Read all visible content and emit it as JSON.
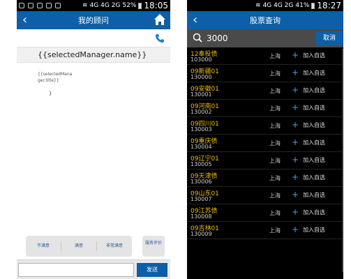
{
  "left_screen": {
    "status": {
      "signal_text": "4G 4G 2G",
      "battery": "52%",
      "time": "18:05"
    },
    "header": {
      "title": "我的顾问"
    },
    "manager": {
      "name": "{{selectedManager.name}}",
      "title": "{{selectedManager.title}}",
      "close_brace": "}"
    },
    "rating_buttons": [
      "不满意",
      "满意",
      "非常满意"
    ],
    "service_eval": "服务评价",
    "input": {
      "value": "",
      "placeholder": ""
    },
    "send_label": "发送"
  },
  "right_screen": {
    "status": {
      "signal_text": "4G 4G 2G",
      "battery": "41%",
      "time": "18:27"
    },
    "header": {
      "title": "股票查询"
    },
    "search": {
      "query": "3000"
    },
    "cancel_label": "取消",
    "stocks": [
      {
        "name": "12奉投债",
        "code": "103000",
        "area": "上海",
        "action": "加入自选"
      },
      {
        "name": "09新疆01",
        "code": "130000",
        "area": "上海",
        "action": "加入自选"
      },
      {
        "name": "09安徽01",
        "code": "130001",
        "area": "上海",
        "action": "加入自选"
      },
      {
        "name": "09河南01",
        "code": "130002",
        "area": "上海",
        "action": "加入自选"
      },
      {
        "name": "09四川01",
        "code": "130003",
        "area": "上海",
        "action": "加入自选"
      },
      {
        "name": "09重庆债",
        "code": "130004",
        "area": "上海",
        "action": "加入自选"
      },
      {
        "name": "09辽宁01",
        "code": "130005",
        "area": "上海",
        "action": "加入自选"
      },
      {
        "name": "09天津债",
        "code": "130006",
        "area": "上海",
        "action": "加入自选"
      },
      {
        "name": "09山东01",
        "code": "130007",
        "area": "上海",
        "action": "加入自选"
      },
      {
        "name": "09江苏债",
        "code": "130008",
        "area": "上海",
        "action": "加入自选"
      },
      {
        "name": "09吉林01",
        "code": "130009",
        "area": "上海",
        "action": "加入自选"
      }
    ]
  },
  "colors": {
    "header_blue": "#0c5fa8",
    "stock_name": "#f0c000",
    "plus_blue": "#4aa0e8"
  }
}
